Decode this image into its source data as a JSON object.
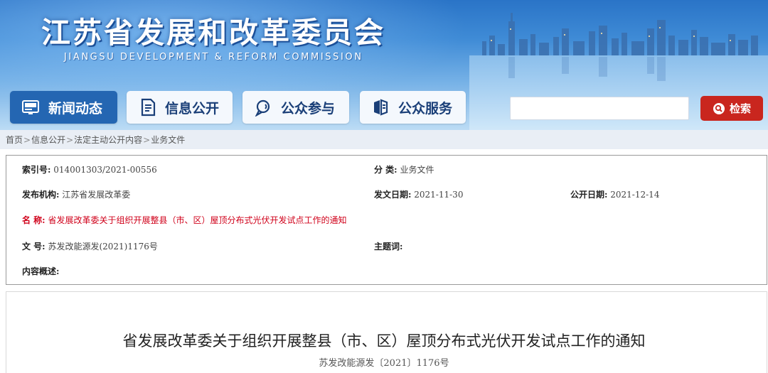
{
  "header": {
    "site_title": "江苏省发展和改革委员会",
    "site_subtitle": "JIANGSU DEVELOPMENT & REFORM COMMISSION",
    "brand_color": "#2466b2"
  },
  "nav": {
    "items": [
      {
        "label": "新闻动态",
        "icon": "newspaper-icon"
      },
      {
        "label": "信息公开",
        "icon": "document-icon"
      },
      {
        "label": "公众参与",
        "icon": "chat-icon"
      },
      {
        "label": "公众服务",
        "icon": "service-icon"
      }
    ],
    "active_index": 0
  },
  "search": {
    "value": "",
    "placeholder": "",
    "button_label": "检索",
    "button_color": "#c9261e"
  },
  "breadcrumb": {
    "items": [
      "首页",
      "信息公开",
      "法定主动公开内容",
      "业务文件"
    ],
    "separator": ">"
  },
  "info": {
    "index_label": "索引号:",
    "index_value": "014001303/2021-00556",
    "category_label": "分 类:",
    "category_value": "业务文件",
    "publisher_label": "发布机构:",
    "publisher_value": "江苏省发展改革委",
    "issue_date_label": "发文日期:",
    "issue_date_value": "2021-11-30",
    "publish_date_label": "公开日期:",
    "publish_date_value": "2021-12-14",
    "name_label": "名 称:",
    "name_value": "省发展改革委关于组织开展整县（市、区）屋顶分布式光伏开发试点工作的通知",
    "docno_label": "文 号:",
    "docno_value": "苏发改能源发(2021)1176号",
    "keywords_label": "主题词:",
    "keywords_value": "",
    "summary_label": "内容概述:",
    "summary_value": "",
    "highlight_color": "#d0021b"
  },
  "article": {
    "title": "省发展改革委关于组织开展整县（市、区）屋顶分布式光伏开发试点工作的通知",
    "doc_number": "苏发改能源发〔2021〕1176号"
  }
}
